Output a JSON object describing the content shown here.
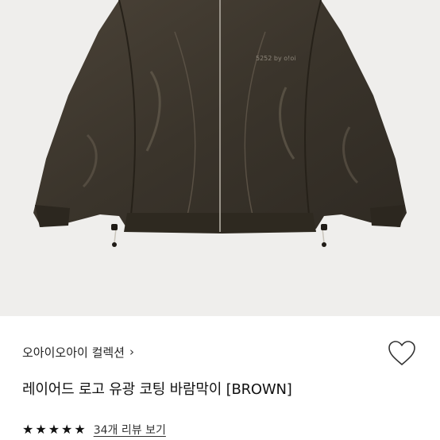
{
  "product": {
    "brand_label": "오아이오아이 컬렉션",
    "brand_chevron": "›",
    "title": "레이어드 로고 유광 코팅 바람막이 [BROWN]",
    "logo_text": "5252 by o!oi",
    "rating_stars": 5,
    "review_link": "34개 리뷰 보기"
  },
  "icons": {
    "wishlist": "heart-outline-icon",
    "star": "star-filled-icon"
  },
  "colors": {
    "jacket": "#3a342b",
    "hero_bg": "#efeeec",
    "text": "#111111"
  }
}
